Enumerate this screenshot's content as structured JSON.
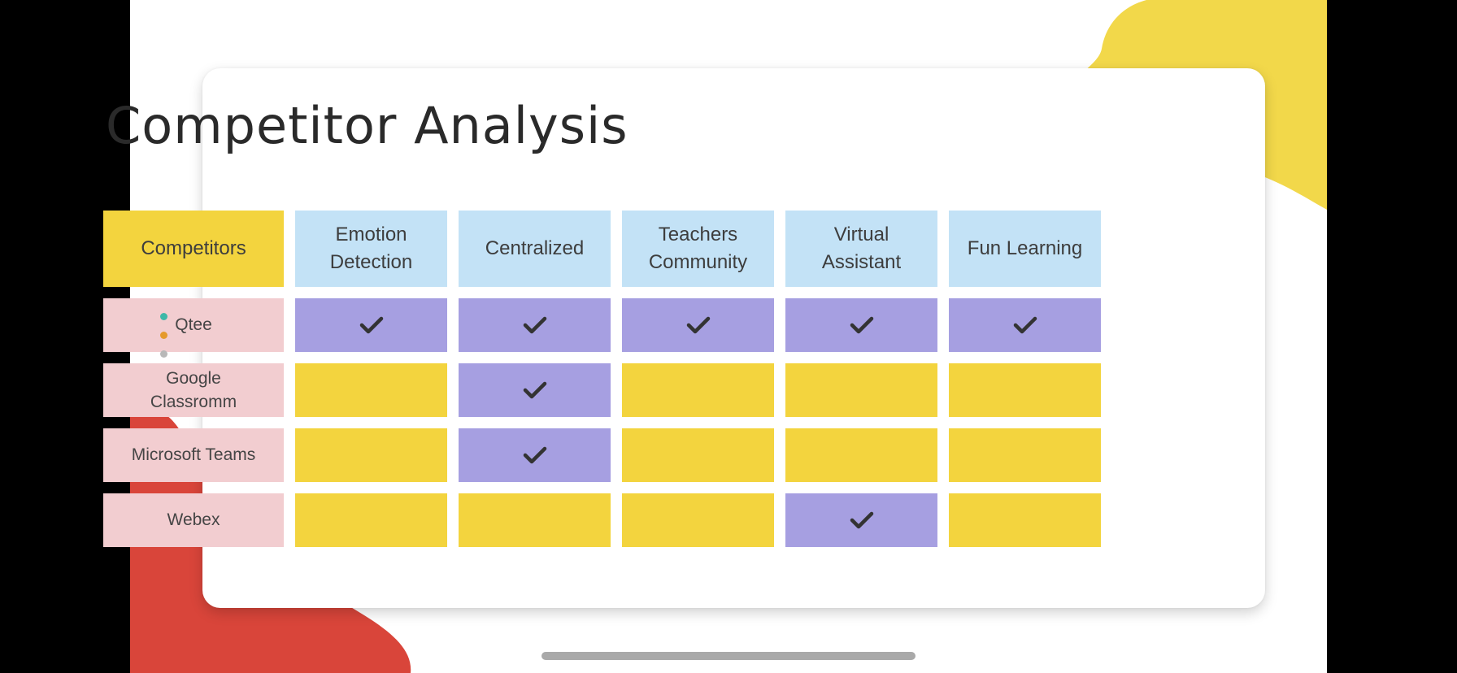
{
  "slide": {
    "title": "Competitor Analysis"
  },
  "table": {
    "corner_label": "Competitors",
    "features": [
      {
        "line1": "Emotion",
        "line2": "Detection"
      },
      {
        "line1": "Centralized",
        "line2": ""
      },
      {
        "line1": "Teachers",
        "line2": "Community"
      },
      {
        "line1": "Virtual",
        "line2": "Assistant"
      },
      {
        "line1": "Fun Learning",
        "line2": ""
      }
    ],
    "rows": [
      {
        "line1": "Qtee",
        "line2": "",
        "checks": [
          true,
          true,
          true,
          true,
          true
        ]
      },
      {
        "line1": "Google",
        "line2": "Classromm",
        "checks": [
          false,
          true,
          false,
          false,
          false
        ]
      },
      {
        "line1": "Microsoft Teams",
        "line2": "",
        "checks": [
          false,
          true,
          false,
          false,
          false
        ]
      },
      {
        "line1": "Webex",
        "line2": "",
        "checks": [
          false,
          false,
          false,
          true,
          false
        ]
      }
    ],
    "check_icon": "checkmark-icon"
  },
  "colors": {
    "header_yellow": "#f3d43e",
    "header_blue": "#c3e2f6",
    "row_label_pink": "#f2cdd0",
    "check_purple": "#a69fe1",
    "empty_yellow": "#f3d43e",
    "blob_yellow": "#f2d84a",
    "blob_red": "#d9453a",
    "dot_teal": "#3db8a8",
    "dot_orange": "#e59a2c",
    "dot_gray": "#b8b8b8"
  }
}
